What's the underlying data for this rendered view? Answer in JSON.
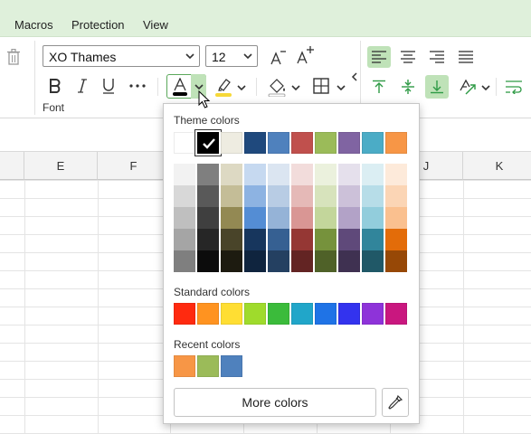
{
  "menubar": {
    "items": [
      "Macros",
      "Protection",
      "View"
    ]
  },
  "ribbon": {
    "font_name": "XO Thames",
    "font_size": "12",
    "group_label": "Font",
    "font_color_value": "#000000",
    "highlight_color_value": "#f6d838",
    "icons": {
      "delete": "trash-icon",
      "decrease_font": "decrease-font-size-icon",
      "increase_font": "increase-font-size-icon",
      "bold": "bold-icon",
      "italic": "italic-icon",
      "underline": "underline-icon",
      "more": "more-options-icon",
      "font_color": "font-color-icon",
      "highlight": "highlight-icon",
      "fill": "fill-color-icon",
      "borders": "borders-icon",
      "align_left": "align-left-icon",
      "align_center": "align-center-icon",
      "align_right": "align-right-icon",
      "justify": "justify-icon",
      "align_top": "align-top-icon",
      "align_middle": "align-middle-icon",
      "align_bottom": "align-bottom-icon",
      "text_orientation": "text-orientation-icon",
      "wrap_text": "wrap-text-icon"
    }
  },
  "grid": {
    "columns": [
      "E",
      "F",
      "",
      "",
      "",
      "J",
      "K"
    ]
  },
  "color_popup": {
    "theme_label": "Theme colors",
    "theme_colors": [
      "#ffffff",
      "#000000",
      "#eeece1",
      "#1f497d",
      "#4f81bd",
      "#c0504d",
      "#9bbb59",
      "#8064a2",
      "#4bacc6",
      "#f79646"
    ],
    "selected_theme_index": 1,
    "tints": [
      [
        "#f2f2f2",
        "#7f7f7f",
        "#ddd9c3",
        "#c6d9f0",
        "#dbe5f1",
        "#f2dcdb",
        "#ebf1dd",
        "#e5e0ec",
        "#dbeef3",
        "#fdeada"
      ],
      [
        "#d8d8d8",
        "#595959",
        "#c4bd97",
        "#8db3e2",
        "#b8cce4",
        "#e5b9b7",
        "#d7e3bc",
        "#ccc1d9",
        "#b7dde8",
        "#fbd5b5"
      ],
      [
        "#bfbfbf",
        "#3f3f3f",
        "#938953",
        "#548dd4",
        "#95b3d7",
        "#d99694",
        "#c3d69b",
        "#b2a2c7",
        "#92cddc",
        "#fac08f"
      ],
      [
        "#a5a5a5",
        "#262626",
        "#494429",
        "#17365d",
        "#366092",
        "#953734",
        "#76923c",
        "#5f497a",
        "#31859b",
        "#e36c09"
      ],
      [
        "#7f7f7f",
        "#0c0c0c",
        "#1d1b10",
        "#0f243e",
        "#244061",
        "#632423",
        "#4f6128",
        "#3f3151",
        "#205867",
        "#974806"
      ]
    ],
    "standard_label": "Standard colors",
    "standard_colors": [
      "#ff2a0f",
      "#ff9320",
      "#ffde33",
      "#9fdb2c",
      "#3bbb3b",
      "#21a6c9",
      "#1f73e6",
      "#3333ee",
      "#8e33d9",
      "#c9177f"
    ],
    "recent_label": "Recent colors",
    "recent_colors": [
      "#f79646",
      "#9bbb59",
      "#4f81bd"
    ],
    "more_colors_label": "More colors",
    "eyedropper_icon": "eyedropper-icon"
  }
}
